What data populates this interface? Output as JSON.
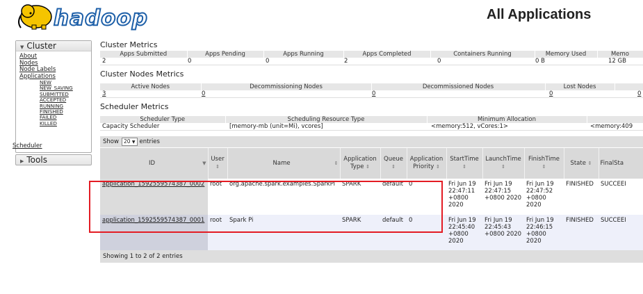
{
  "header": {
    "logo_text": "hadoop",
    "title": "All Applications"
  },
  "sidebar": {
    "cluster_label": "Cluster",
    "links": [
      "About",
      "Nodes",
      "Node Labels",
      "Applications"
    ],
    "states": [
      "NEW",
      "NEW_SAVING",
      "SUBMITTED",
      "ACCEPTED",
      "RUNNING",
      "FINISHED",
      "FAILED",
      "KILLED"
    ],
    "scheduler_label": "Scheduler",
    "tools_label": "Tools"
  },
  "cluster_metrics": {
    "title": "Cluster Metrics",
    "headers": [
      "Apps Submitted",
      "Apps Pending",
      "Apps Running",
      "Apps Completed",
      "Containers Running",
      "Memory Used",
      "Memo"
    ],
    "values": [
      "2",
      "0",
      "0",
      "2",
      "0",
      "0 B",
      "12 GB"
    ]
  },
  "cluster_nodes_metrics": {
    "title": "Cluster Nodes Metrics",
    "headers": [
      "Active Nodes",
      "Decommissioning Nodes",
      "Decommissioned Nodes",
      "Lost Nodes"
    ],
    "values": [
      "3",
      "0",
      "0",
      "0",
      "0"
    ]
  },
  "scheduler_metrics": {
    "title": "Scheduler Metrics",
    "headers": [
      "Scheduler Type",
      "Scheduling Resource Type",
      "Minimum Allocation"
    ],
    "values": [
      "Capacity Scheduler",
      "[memory-mb (unit=Mi), vcores]",
      "<memory:512, vCores:1>",
      "<memory:409"
    ]
  },
  "show_entries": {
    "prefix": "Show",
    "selected": "20",
    "suffix": "entries"
  },
  "apps_table": {
    "columns": [
      "ID",
      "User",
      "Name",
      "Application Type",
      "Queue",
      "Application Priority",
      "StartTime",
      "LaunchTime",
      "FinishTime",
      "State",
      "FinalSta"
    ],
    "rows": [
      {
        "id": "application_1592559574387_0002",
        "user": "root",
        "name": "org.apache.spark.examples.SparkPi",
        "type": "SPARK",
        "queue": "default",
        "priority": "0",
        "start": "Fri Jun 19 22:47:11 +0800 2020",
        "launch": "Fri Jun 19 22:47:15 +0800 2020",
        "finish": "Fri Jun 19 22:47:52 +0800 2020",
        "state": "FINISHED",
        "final": "SUCCEEI"
      },
      {
        "id": "application_1592559574387_0001",
        "user": "root",
        "name": "Spark Pi",
        "type": "SPARK",
        "queue": "default",
        "priority": "0",
        "start": "Fri Jun 19 22:45:40 +0800 2020",
        "launch": "Fri Jun 19 22:45:43 +0800 2020",
        "finish": "Fri Jun 19 22:46:15 +0800 2020",
        "state": "FINISHED",
        "final": "SUCCEEI"
      }
    ]
  },
  "footer": {
    "info": "Showing 1 to 2 of 2 entries"
  },
  "colors": {
    "highlight": "#e31b23",
    "logo_yellow": "#f5c400",
    "logo_blue": "#1d5fa8"
  }
}
